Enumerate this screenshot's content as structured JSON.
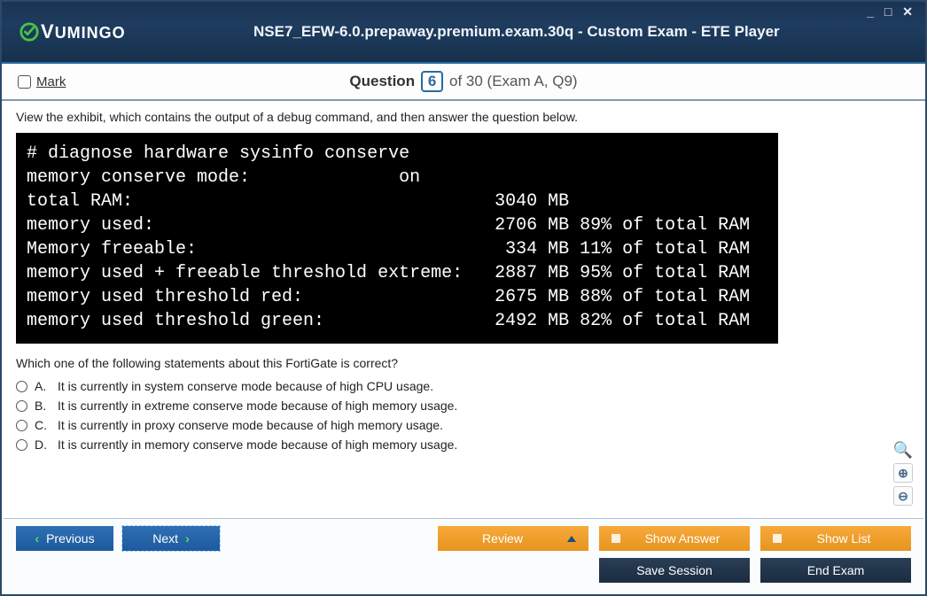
{
  "window": {
    "controls": "_ □ ✕"
  },
  "header": {
    "brand_prefix": "V",
    "brand": "UMINGO",
    "title": "NSE7_EFW-6.0.prepaway.premium.exam.30q - Custom Exam - ETE Player"
  },
  "subheader": {
    "mark_label": "Mark",
    "q_word": "Question",
    "q_num": "6",
    "q_rest": " of 30 (Exam A, Q9)"
  },
  "question": {
    "instruction": "View the exhibit, which contains the output of a debug command, and then answer the question below.",
    "exhibit": "# diagnose hardware sysinfo conserve\nmemory conserve mode:              on\ntotal RAM:                                  3040 MB\nmemory used:                                2706 MB 89% of total RAM\nMemory freeable:                             334 MB 11% of total RAM\nmemory used + freeable threshold extreme:   2887 MB 95% of total RAM\nmemory used threshold red:                  2675 MB 88% of total RAM\nmemory used threshold green:                2492 MB 82% of total RAM",
    "prompt": "Which one of the following statements about this FortiGate is correct?",
    "options": [
      {
        "letter": "A.",
        "text": "It is currently in system conserve mode because of high CPU usage."
      },
      {
        "letter": "B.",
        "text": "It is currently in extreme conserve mode because of high memory usage."
      },
      {
        "letter": "C.",
        "text": "It is currently in proxy conserve mode because of high memory usage."
      },
      {
        "letter": "D.",
        "text": "It is currently in memory conserve mode because of high memory usage."
      }
    ]
  },
  "footer": {
    "previous": "Previous",
    "next": "Next",
    "review": "Review",
    "show_answer": "Show Answer",
    "show_list": "Show List",
    "save_session": "Save Session",
    "end_exam": "End Exam"
  }
}
